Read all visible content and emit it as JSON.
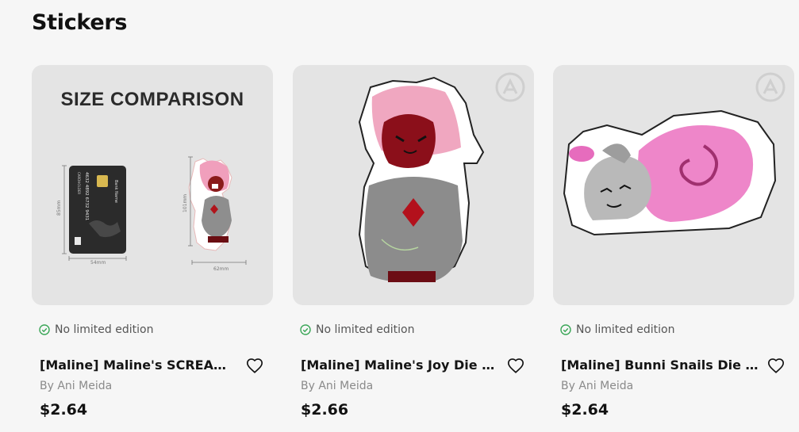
{
  "section": {
    "title": "Stickers"
  },
  "products": [
    {
      "edition": "No limited edition",
      "title": "[Maline] Maline's SCREAM o...",
      "author": "By Ani Meida",
      "price": "$2.64",
      "size_comparison_title": "SIZE COMPARISON",
      "card_labels": {
        "bank": "Bank Name",
        "number": "4632 4892 6732 9431",
        "holder": "CARDHOLDER",
        "w": "54mm",
        "h": "85mm"
      },
      "sticker_labels": {
        "w": "62mm",
        "h": "101mm"
      }
    },
    {
      "edition": "No limited edition",
      "title": "[Maline] Maline's Joy Die Cu...",
      "author": "By Ani Meida",
      "price": "$2.66"
    },
    {
      "edition": "No limited edition",
      "title": "[Maline] Bunni Snails Die C...",
      "author": "By Ani Meida",
      "price": "$2.64"
    }
  ],
  "icons": {
    "edition": "check-circle-icon",
    "favorite": "heart-outline-icon",
    "watermark": "logo-watermark-icon"
  },
  "colors": {
    "check": "#3aa657",
    "thumb_bg": "#e4e4e4",
    "page_bg": "#f6f6f6"
  }
}
